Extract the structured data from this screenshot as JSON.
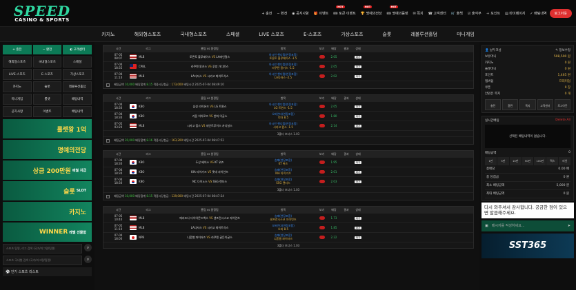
{
  "logo": {
    "line1": "SPEED",
    "line2": "CASINO & SPORTS"
  },
  "top_nav": [
    {
      "label": "+ 충전",
      "hot": ""
    },
    {
      "label": "− 환전",
      "hot": ""
    },
    {
      "label": "◉ 공지사항",
      "hot": ""
    },
    {
      "label": "🎁 이벤트",
      "hot": ""
    },
    {
      "label": "🎟 토큰 이벤트",
      "hot": "HOT"
    },
    {
      "label": "🏆 명예의전당",
      "hot": "HOT"
    },
    {
      "label": "🎟 명예의룰렛",
      "hot": "HOT"
    },
    {
      "label": "✉ 쪽지",
      "hot": ""
    },
    {
      "label": "☎ 고객센터",
      "hot": ""
    },
    {
      "label": "🛒 출첵",
      "hot": ""
    },
    {
      "label": "☑ 출석부",
      "hot": ""
    },
    {
      "label": "＋ 포인트",
      "hot": ""
    },
    {
      "label": "▤ 마이페이지",
      "hot": ""
    },
    {
      "label": "✓ 배팅내역",
      "hot": ""
    }
  ],
  "logout": "로그아웃",
  "main_nav": [
    "카지노",
    "해외형스포츠",
    "국내형스포츠",
    "스페셜",
    "LIVE 스포츠",
    "E-스포츠",
    "가상스포츠",
    "슬롯",
    "레볼루션홀덤",
    "미니게임"
  ],
  "left": {
    "actions": [
      "+ 충전",
      "− 환전",
      "◐ 고객센터"
    ],
    "menu": [
      "해외형스포츠",
      "국내형스포츠",
      "스페셜",
      "LIVE-스포츠",
      "E-스포츠",
      "가상스포츠",
      "카지노",
      "슬롯",
      "레볼루션홀덤",
      "미니게임",
      "룰렛",
      "배팅내역",
      "공지사항",
      "이벤트",
      "배팅내역"
    ],
    "banners": [
      {
        "main": "룰렛왕 1억",
        "sub": ""
      },
      {
        "main": "명예의전당",
        "sub": ""
      },
      {
        "main": "상금 200만원",
        "sub": "매월 지급"
      },
      {
        "main": "슬롯",
        "sub": "SLOT"
      },
      {
        "main": "카지노",
        "sub": ""
      },
      {
        "main": "WINNER",
        "sub": "레벨 선물함"
      }
    ],
    "search1": "스포츠 팀명, 리그 검색 (국가/리그명/팀명)",
    "search2": "스포츠 국내형 검색 (국가/리그명/팀명)",
    "popular": "⚽ 인기 스포츠 리스트"
  },
  "table_headers": [
    "",
    "시간",
    "리그",
    "홈팀 vs 원정팀",
    "항목",
    "보기",
    "배당",
    "결과",
    "상태"
  ],
  "groups": [
    {
      "rows": [
        {
          "date": "07-05",
          "time": "08:07",
          "flag": "us",
          "league": "MLB",
          "home": "토론토 블루제이스",
          "away": "LA에인절스",
          "bet": "아시안 핸디캡(연장포함)",
          "pick": "토론토 블루제이스 -1.5",
          "odd": "2.05",
          "status": "대기"
        },
        {
          "date": "07-04",
          "time": "18:35",
          "flag": "tw",
          "league": "CPBL",
          "home": "라쿠텐 몽키스",
          "away": "푸방 가디언스",
          "bet": "아시안 핸디캡(연장포함)",
          "pick": "라쿠텐 몽키스 -1.5",
          "odd": "2.05",
          "status": "대기"
        },
        {
          "date": "07-04",
          "time": "11:10",
          "flag": "us",
          "league": "MLB",
          "home": "LA다저스",
          "away": "시카고 화이트삭스",
          "bet": "아시안 핸디캡(연장포함)",
          "pick": "LA다저스 -2.5",
          "odd": "2.02",
          "status": "대기"
        }
      ],
      "footer": {
        "a": "배팅금액",
        "b": "10,000",
        "c": "배당합계",
        "d": "8.15",
        "e": "적중시당첨금 :",
        "f": "173,000",
        "g": "배팅시간 2025-07-04 08:49:10"
      },
      "bonus": ""
    },
    {
      "rows": [
        {
          "date": "07-04",
          "time": "18:30",
          "flag": "kr",
          "league": "KBO",
          "home": "삼성 라이온즈",
          "away": "LG 트윈스",
          "bet": "아시안 핸디캡(연장포함)",
          "pick": "LG 트윈스 -1.5",
          "odd": "2.05",
          "status": "대기"
        },
        {
          "date": "07-04",
          "time": "18:30",
          "flag": "kr",
          "league": "KBO",
          "home": "키움 히어로즈",
          "away": "한화 이글스",
          "bet": "오버언더(연장포함)",
          "pick": "언더 8.5",
          "odd": "1.80",
          "status": "대기"
        },
        {
          "date": "07-05",
          "time": "03:20",
          "flag": "us",
          "league": "MLB",
          "home": "시카고 컵스",
          "away": "세인트루이스 카디널스",
          "bet": "아시안 핸디캡(연장포함)",
          "pick": "시카고 컵스 -1.5",
          "odd": "2.14",
          "status": "대기"
        }
      ],
      "footer": {
        "a": "배팅금액",
        "b": "20,000",
        "c": "배당합계",
        "d": "8.16",
        "e": "적중시당첨금 :",
        "f": "163,200",
        "g": "배팅시간 2025-07-04 08:47:52"
      },
      "bonus": "3폴더 보너스 1.03"
    },
    {
      "rows": [
        {
          "date": "07-04",
          "time": "18:30",
          "flag": "kr",
          "league": "KBO",
          "home": "두산 베어스",
          "away": "KT 위즈",
          "bet": "승패(연장포함)",
          "pick": "KT 위즈",
          "odd": "1.95",
          "status": "대기"
        },
        {
          "date": "07-04",
          "time": "18:30",
          "flag": "kr",
          "league": "KBO",
          "home": "KIA 타이거즈",
          "away": "롯데 자이언츠",
          "bet": "승패(연장포함)",
          "pick": "KIA 타이거즈",
          "odd": "2.01",
          "status": "대기"
        },
        {
          "date": "07-04",
          "time": "18:30",
          "flag": "kr",
          "league": "KBO",
          "home": "NC 다이노스",
          "away": "SSG 랜더스",
          "bet": "승패(연장포함)",
          "pick": "SSG 랜더스",
          "odd": "2.03",
          "status": "대기"
        }
      ],
      "footer": {
        "a": "배팅금액",
        "b": "10,000",
        "c": "배당합계",
        "d": "8.15",
        "e": "적중시당첨금 :",
        "f": "139,000",
        "g": "배팅시간 2025-07-04 08:47:24"
      },
      "bonus": "3폴더 보너스 1.03"
    },
    {
      "rows": [
        {
          "date": "07-05",
          "time": "10:40",
          "flag": "us",
          "league": "MLB",
          "home": "애리조나 다이아몬드백스",
          "away": "샌프란시스코 자이언츠",
          "bet": "승패(연장포함)",
          "pick": "샌프란시스코 자이언츠",
          "odd": "1.73",
          "status": "대기"
        },
        {
          "date": "07-05",
          "time": "11:10",
          "flag": "us",
          "league": "MLB",
          "home": "LA다저스",
          "away": "시카고 화이트삭스",
          "bet": "오버언더(연장포함)",
          "pick": "오버 8.5",
          "odd": "1.85",
          "status": "대기"
        },
        {
          "date": "07-04",
          "time": "18:00",
          "flag": "jp",
          "league": "NPB",
          "home": "니혼햄 파이터즈",
          "away": "라쿠텐 골든이글스",
          "bet": "승패(연장포함)",
          "pick": "니혼햄 파이터즈",
          "odd": "2.22",
          "status": "대기"
        }
      ],
      "footer": {
        "a": "",
        "b": "",
        "c": "",
        "d": "",
        "e": "",
        "f": "",
        "g": ""
      },
      "bonus": "3폴더 보너스 1.03"
    }
  ],
  "right": {
    "user": "👤 날두코님",
    "user_info": "✎ 정보수정",
    "balances": [
      {
        "k": "보유머니",
        "v": "508,500 원"
      },
      {
        "k": "카지노",
        "v": "0 원"
      },
      {
        "k": "슬롯머니",
        "v": "0 원"
      },
      {
        "k": "포인트",
        "v": "1,465 원"
      },
      {
        "k": "멤버쉽",
        "v": "프리미엄"
      },
      {
        "k": "쿠폰",
        "v": "0 장"
      },
      {
        "k": "안읽은 쪽지",
        "v": "0 개"
      }
    ],
    "buttons": [
      "충전",
      "환전",
      "쪽지",
      "고객센터",
      "로그아웃"
    ],
    "slip_title": "실시간배팅",
    "slip_delete": "Delete All",
    "slip_msg": "선택된 배팅내역이 없습니다.",
    "amount_label": "배팅금액",
    "amount_value": "0",
    "quick": [
      "1만",
      "5만",
      "10만",
      "50만",
      "100만",
      "맥스",
      "리셋"
    ],
    "calc": [
      {
        "k": "총배당",
        "v": "0.00 배"
      },
      {
        "k": "총 당첨금",
        "v": "0 원"
      },
      {
        "k": "최소 배팅금액",
        "v": "5,000 원"
      },
      {
        "k": "최대 배팅금액",
        "v": "0 원"
      }
    ],
    "chat_msg": "다시 와주셔서 감사합니다. 궁금한 점이 있으면 말씀해주세요.",
    "chat_ph": "메시지를 작성하세요...",
    "sst": "SST365"
  }
}
